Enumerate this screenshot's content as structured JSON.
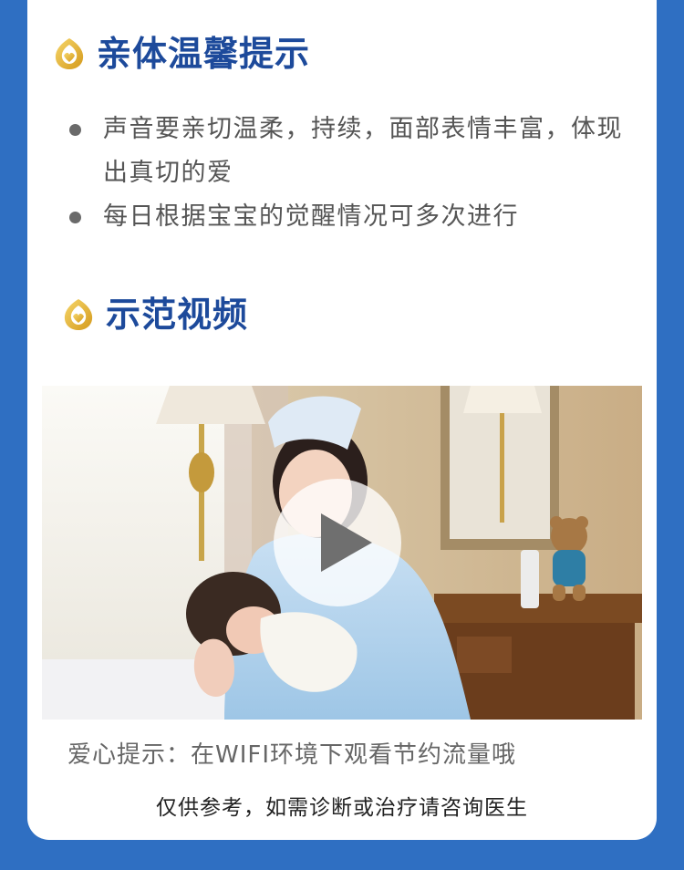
{
  "sections": {
    "tips": {
      "title": "亲体温馨提示",
      "bullets": [
        "声音要亲切温柔，持续，面部表情丰富，体现出真切的爱",
        "每日根据宝宝的觉醒情况可多次进行"
      ]
    },
    "video": {
      "title": "示范视频",
      "thumbnail_icon": "play-icon"
    }
  },
  "footer": {
    "tip": "爱心提示：在WIFI环境下观看节约流量哦",
    "disclaimer": "仅供参考，如需诊断或治疗请咨询医生"
  },
  "colors": {
    "page_background": "#2f6fc2",
    "title": "#1d4a9b",
    "logo_gold": "#e4b536"
  }
}
